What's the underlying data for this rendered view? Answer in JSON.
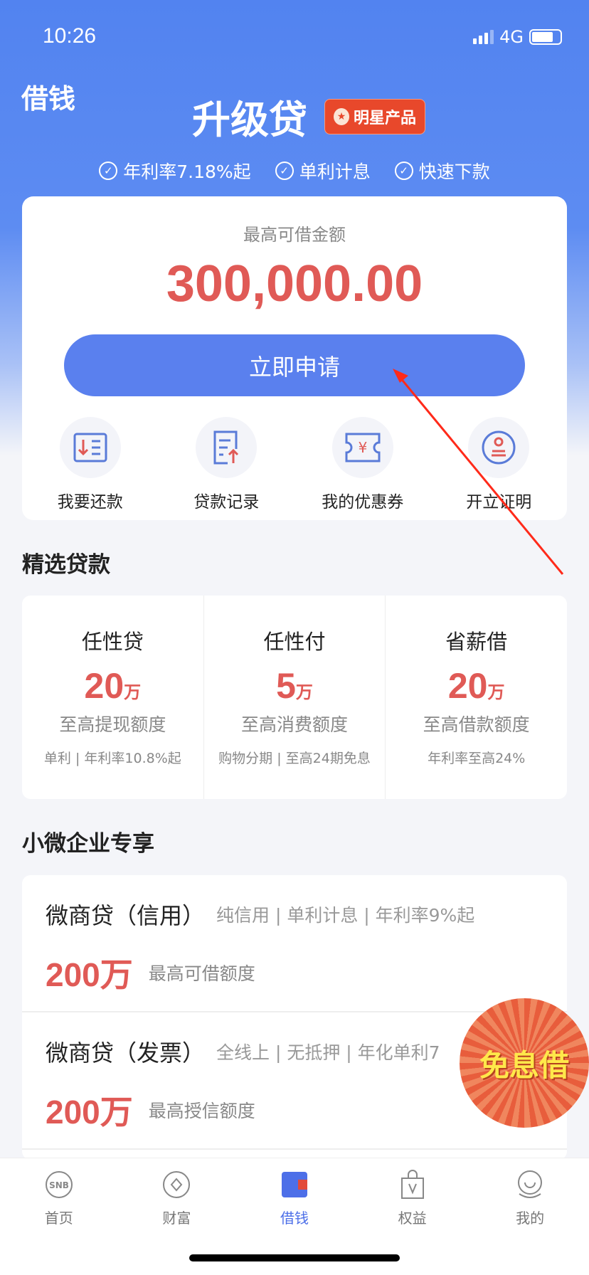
{
  "status": {
    "time": "10:26",
    "network": "4G",
    "battery_level": 0.75
  },
  "header": {
    "page_label": "借钱",
    "title": "升级贷",
    "badge": "明星产品",
    "features": [
      "年利率7.18%起",
      "单利计息",
      "快速下款"
    ]
  },
  "loan_card": {
    "label": "最高可借金额",
    "amount": "300,000.00",
    "apply_button": "立即申请",
    "quick_actions": [
      {
        "label": "我要还款",
        "icon": "repay-icon"
      },
      {
        "label": "贷款记录",
        "icon": "record-icon"
      },
      {
        "label": "我的优惠券",
        "icon": "coupon-icon"
      },
      {
        "label": "开立证明",
        "icon": "stamp-icon"
      }
    ]
  },
  "featured": {
    "title": "精选贷款",
    "products": [
      {
        "name": "任性贷",
        "value": "20",
        "unit": "万",
        "desc": "至高提现额度",
        "sub": "单利 | 年利率10.8%起"
      },
      {
        "name": "任性付",
        "value": "5",
        "unit": "万",
        "desc": "至高消费额度",
        "sub": "购物分期 | 至高24期免息"
      },
      {
        "name": "省薪借",
        "value": "20",
        "unit": "万",
        "desc": "至高借款额度",
        "sub": "年利率至高24%"
      }
    ]
  },
  "business": {
    "title": "小微企业专享",
    "items": [
      {
        "name": "微商贷（信用）",
        "tags": "纯信用 | 单利计息 | 年利率9%起",
        "amount": "200万",
        "amount_label": "最高可借额度"
      },
      {
        "name": "微商贷（发票）",
        "tags": "全线上 | 无抵押 | 年化单利7",
        "amount": "200万",
        "amount_label": "最高授信额度"
      }
    ]
  },
  "promo": {
    "label": "免息借"
  },
  "tabbar": {
    "active": "借钱",
    "items": [
      {
        "label": "首页",
        "icon": "snb-icon"
      },
      {
        "label": "财富",
        "icon": "wealth-icon"
      },
      {
        "label": "借钱",
        "icon": "wallet-icon"
      },
      {
        "label": "权益",
        "icon": "bag-icon"
      },
      {
        "label": "我的",
        "icon": "user-icon"
      }
    ]
  },
  "colors": {
    "primary": "#5a80ee",
    "amount_red": "#e05a56",
    "annotation_arrow": "#ff2a1a"
  }
}
